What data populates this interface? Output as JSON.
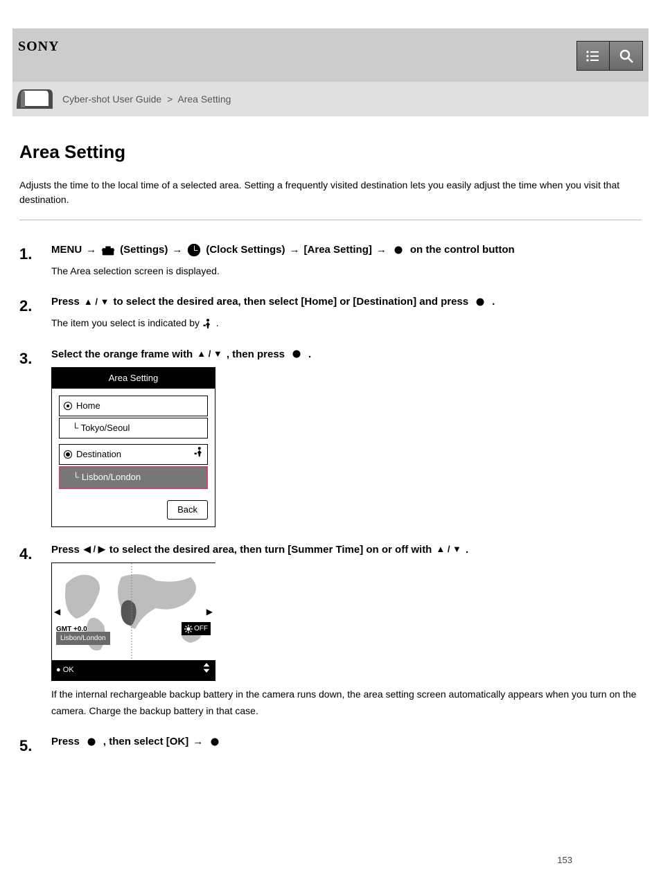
{
  "header": {
    "brand": "SONY",
    "breadcrumb": {
      "a": "Cyber-shot User Guide",
      "sep": ">",
      "b": "Area Setting"
    }
  },
  "title": "Area Setting",
  "intro": "Adjusts the time to the local time of a selected area. Setting a frequently visited destination lets you easily adjust the time when you visit that destination.",
  "steps": {
    "s1": {
      "menu": "MENU",
      "arrow": "→",
      "settings": "(Settings)",
      "clock": "(Clock Settings)",
      "area": "[Area Setting]",
      "center": "on the control button",
      "note": "The Area selection screen is displayed."
    },
    "s2": {
      "lead_a": "Press",
      "lead_b": "to select the desired area, then select [Home] or [Destination] and press",
      "arrows_vert": "▲ / ▼",
      "dot": ".",
      "note": "The item you select is indicated by",
      "indicator": "."
    },
    "s3": {
      "lead_a": "Select the orange frame with",
      "vert": "▲ / ▼",
      "lead_b": ", then press",
      "dot": "."
    },
    "s4": {
      "lead_a": "Press",
      "horiz": "◀ / ▶",
      "lead_b": "to select the desired area, then turn [Summer Time] on or off with",
      "vert": "▲ / ▼",
      "dot": "."
    },
    "s5": {
      "lead_a": "Press ",
      "lead_b": ", then select [OK]",
      "arrow": "→"
    }
  },
  "screen1": {
    "title": "Area Setting",
    "home": "Home",
    "home_area": "Tokyo/Seoul",
    "dest": "Destination",
    "dest_area": "Lisbon/London",
    "back": "Back"
  },
  "screen2": {
    "gmt": "GMT +0.0",
    "region": "Lisbon/London",
    "ok": "OK",
    "dst": "OFF"
  },
  "warning": "If the internal rechargeable backup battery in the camera runs down, the area setting screen automatically appears when you turn on the camera. Charge the backup battery in that case.",
  "page_number": "153"
}
